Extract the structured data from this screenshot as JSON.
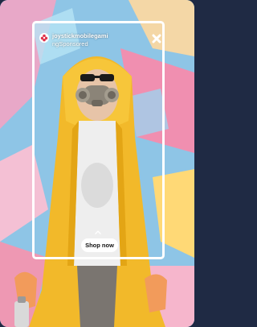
{
  "ad": {
    "account_name": "joystickmobilegami",
    "sponsored_line": "ngSponsored",
    "cta_label": "Shop now"
  },
  "icons": {
    "close": "close-icon",
    "chevron": "chevron-up-icon",
    "avatar": "flower-logo-icon"
  },
  "colors": {
    "accent_red": "#e0324b",
    "raincoat_yellow": "#f2b92a",
    "frame": "#ffffff"
  }
}
